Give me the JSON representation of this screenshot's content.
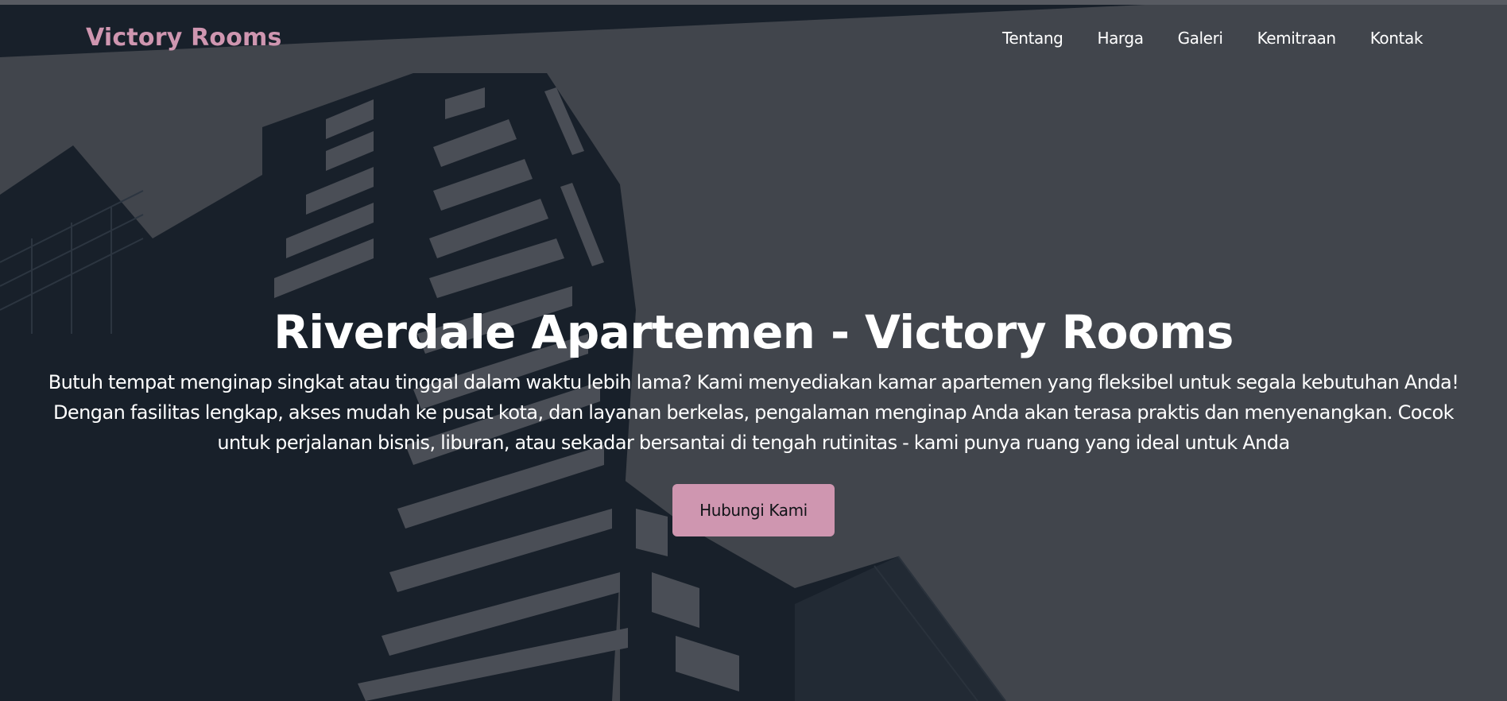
{
  "brand": {
    "name": "Victory Rooms",
    "color": "#cf96b0"
  },
  "nav": {
    "items": [
      {
        "label": "Tentang"
      },
      {
        "label": "Harga"
      },
      {
        "label": "Galeri"
      },
      {
        "label": "Kemitraan"
      },
      {
        "label": "Kontak"
      }
    ]
  },
  "hero": {
    "title": "Riverdale Apartemen - Victory Rooms",
    "description": "Butuh tempat menginap singkat atau tinggal dalam waktu lebih lama? Kami menyediakan kamar apartemen yang fleksibel untuk segala kebutuhan Anda! Dengan fasilitas lengkap, akses mudah ke pusat kota, dan layanan berkelas, pengalaman menginap Anda akan terasa praktis dan menyenangkan. Cocok untuk perjalanan bisnis, liburan, atau sekadar bersantai di tengah rutinitas - kami punya ruang yang ideal untuk Anda",
    "cta_label": "Hubungi Kami",
    "background": "building-silhouette-image"
  },
  "colors": {
    "overlay": "#41454c",
    "shadow": "#18202a",
    "accent": "#cf96b0",
    "text": "#ffffff"
  }
}
